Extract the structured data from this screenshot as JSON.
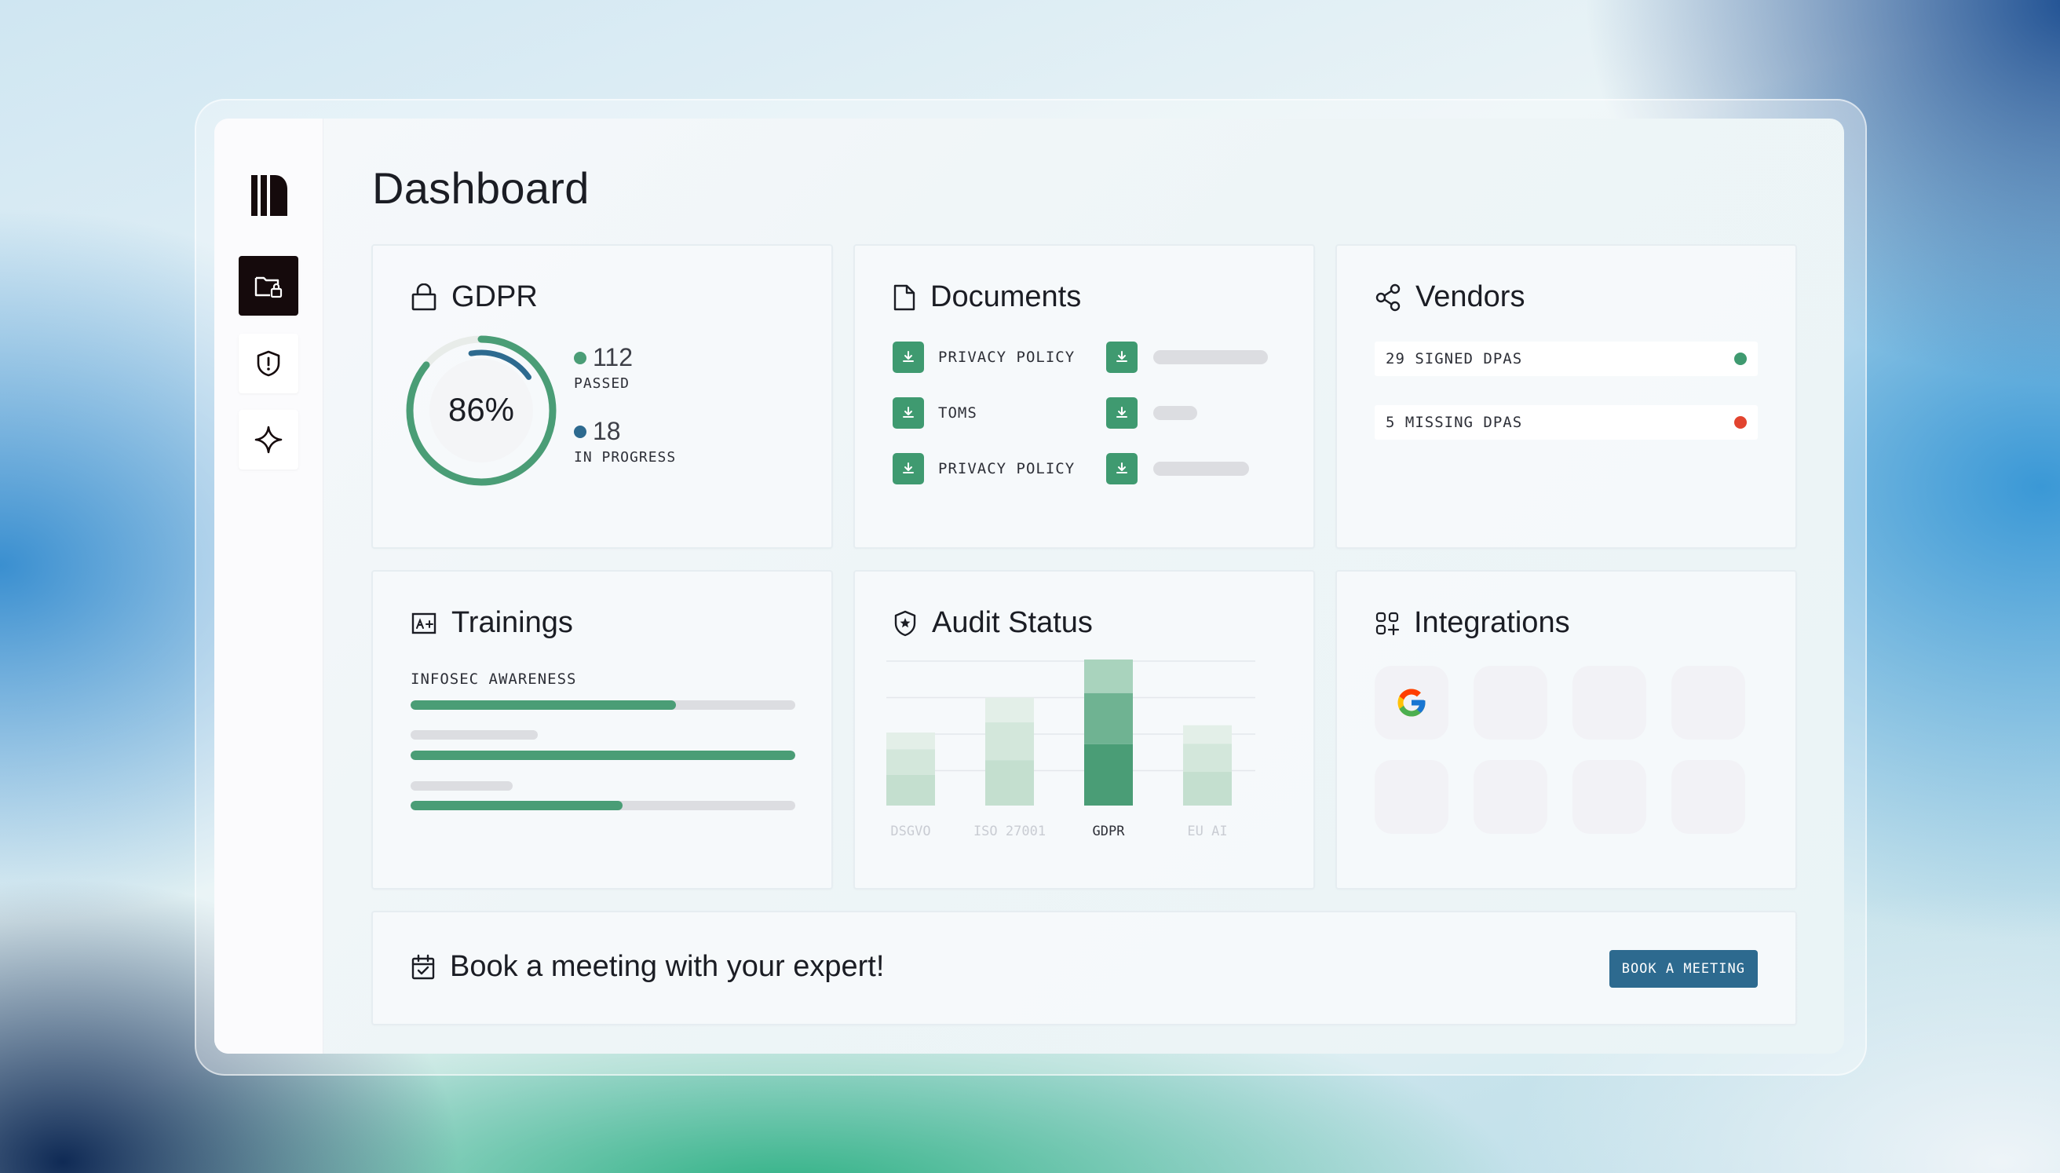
{
  "page": {
    "title": "Dashboard"
  },
  "sidebar": {
    "items": [
      {
        "name": "folder-lock-icon",
        "active": true
      },
      {
        "name": "shield-alert-icon",
        "active": false
      },
      {
        "name": "sparkle-icon",
        "active": false
      }
    ]
  },
  "gdpr": {
    "title": "GDPR",
    "progress_label": "86%",
    "progress_value": 0.86,
    "inner_progress_value": 0.18,
    "passed_count": "112",
    "passed_label": "PASSED",
    "in_progress_count": "18",
    "in_progress_label": "IN PROGRESS"
  },
  "documents": {
    "title": "Documents",
    "items": [
      {
        "label": "PRIVACY POLICY"
      },
      {
        "label": "TOMS"
      },
      {
        "label": "PRIVACY POLICY"
      }
    ]
  },
  "vendors": {
    "title": "Vendors",
    "signed": "29 SIGNED DPAS",
    "missing": "5 MISSING DPAS"
  },
  "trainings": {
    "title": "Trainings",
    "course_label": "INFOSEC AWARENESS",
    "progress": [
      0.69,
      1.0,
      0.55
    ]
  },
  "audit": {
    "title": "Audit Status",
    "chart_data": {
      "type": "bar",
      "categories": [
        "DSGVO",
        "ISO 27001",
        "GDPR",
        "EU AI"
      ],
      "values": [
        50,
        74,
        100,
        55
      ],
      "ylim": [
        0,
        100
      ],
      "highlight": "GDPR"
    }
  },
  "integrations": {
    "title": "Integrations",
    "tiles": [
      "google-icon",
      "",
      "",
      "",
      "",
      "",
      "",
      ""
    ]
  },
  "meeting": {
    "text": "Book a meeting with your expert!",
    "button": "BOOK A MEETING"
  },
  "colors": {
    "accent_green": "#4a9d76",
    "accent_blue": "#2d6a8f",
    "status_ok": "#3f9a70",
    "status_error": "#e2442f"
  }
}
